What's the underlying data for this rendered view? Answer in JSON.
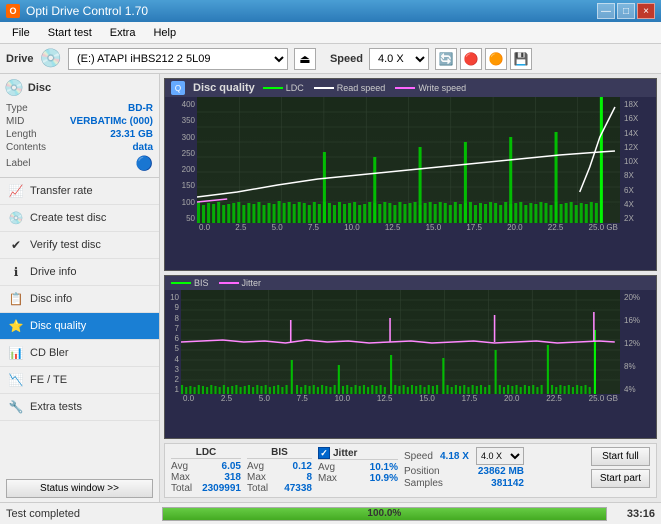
{
  "titleBar": {
    "title": "Opti Drive Control 1.70",
    "icon": "O",
    "controls": [
      "—",
      "□",
      "×"
    ]
  },
  "menuBar": {
    "items": [
      "File",
      "Start test",
      "Extra",
      "Help"
    ]
  },
  "driveBar": {
    "label": "Drive",
    "driveValue": "(E:)  ATAPI iHBS212  2 5L09",
    "speedLabel": "Speed",
    "speedValue": "4.0 X"
  },
  "disc": {
    "header": "Disc",
    "fields": [
      {
        "label": "Type",
        "value": "BD-R"
      },
      {
        "label": "MID",
        "value": "VERBATIMc (000)"
      },
      {
        "label": "Length",
        "value": "23.31 GB"
      },
      {
        "label": "Contents",
        "value": "data"
      },
      {
        "label": "Label",
        "value": ""
      }
    ]
  },
  "navItems": [
    {
      "id": "transfer-rate",
      "label": "Transfer rate",
      "icon": "📈"
    },
    {
      "id": "create-test-disc",
      "label": "Create test disc",
      "icon": "💿"
    },
    {
      "id": "verify-test-disc",
      "label": "Verify test disc",
      "icon": "✔"
    },
    {
      "id": "drive-info",
      "label": "Drive info",
      "icon": "ℹ"
    },
    {
      "id": "disc-info",
      "label": "Disc info",
      "icon": "📋"
    },
    {
      "id": "disc-quality",
      "label": "Disc quality",
      "icon": "⭐",
      "active": true
    },
    {
      "id": "cd-bler",
      "label": "CD Bler",
      "icon": "📊"
    },
    {
      "id": "fe-te",
      "label": "FE / TE",
      "icon": "📉"
    },
    {
      "id": "extra-tests",
      "label": "Extra tests",
      "icon": "🔧"
    }
  ],
  "statusWindowBtn": "Status window >>",
  "discQuality": {
    "title": "Disc quality",
    "charts": {
      "top": {
        "title": "Disc quality",
        "legend": [
          "LDC",
          "Read speed",
          "Write speed"
        ],
        "legendColors": [
          "#00ff00",
          "#ffffff",
          "#ff66ff"
        ],
        "yLabels": [
          "400",
          "350",
          "300",
          "250",
          "200",
          "150",
          "100",
          "50"
        ],
        "yLabelsRight": [
          "18X",
          "16X",
          "14X",
          "12X",
          "10X",
          "8X",
          "6X",
          "4X",
          "2X"
        ],
        "xLabels": [
          "0.0",
          "2.5",
          "5.0",
          "7.5",
          "10.0",
          "12.5",
          "15.0",
          "17.5",
          "20.0",
          "22.5",
          "25.0 GB"
        ]
      },
      "bottom": {
        "legend": [
          "BIS",
          "Jitter"
        ],
        "legendColors": [
          "#00ff00",
          "#ff66ff"
        ],
        "yLabels": [
          "10",
          "9",
          "8",
          "7",
          "6",
          "5",
          "4",
          "3",
          "2",
          "1"
        ],
        "yLabelsRight": [
          "20%",
          "16%",
          "12%",
          "8%",
          "4%"
        ],
        "xLabels": [
          "0.0",
          "2.5",
          "5.0",
          "7.5",
          "10.0",
          "12.5",
          "15.0",
          "17.5",
          "20.0",
          "22.5",
          "25.0 GB"
        ]
      }
    },
    "stats": {
      "ldc": {
        "header": "LDC",
        "avg": "6.05",
        "max": "318",
        "total": "2309991"
      },
      "bis": {
        "header": "BIS",
        "avg": "0.12",
        "max": "8",
        "total": "47338"
      },
      "jitter": {
        "header": "Jitter",
        "checked": true,
        "avg": "10.1%",
        "max": "10.9%"
      },
      "speed": {
        "label": "Speed",
        "value": "4.18 X",
        "target": "4.0 X"
      },
      "position": {
        "label": "Position",
        "value": "23862 MB"
      },
      "samples": {
        "label": "Samples",
        "value": "381142"
      }
    },
    "buttons": {
      "startFull": "Start full",
      "startPart": "Start part"
    },
    "rowLabels": [
      "Avg",
      "Max",
      "Total"
    ]
  },
  "statusBar": {
    "text": "Test completed",
    "progress": 100,
    "progressText": "100.0%",
    "time": "33:16"
  }
}
